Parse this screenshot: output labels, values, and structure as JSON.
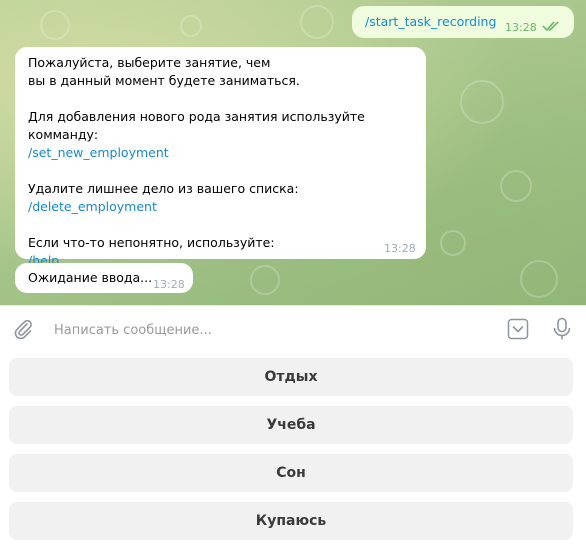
{
  "chat": {
    "outgoing": {
      "text": "/start_task_recording",
      "time": "13:28"
    },
    "bot_message": {
      "line1": "Пожалуйста, выберите занятие, чем",
      "line2": "вы в данный момент будете заниматься.",
      "line3": "Для добавления нового рода занятия используйте комманду:",
      "link1": "/set_new_employment",
      "line4": "Удалите лишнее дело из вашего списка:",
      "link2": "/delete_employment",
      "line5": "Если что-то непонятно, используйте:",
      "link3": "/help",
      "time": "13:28"
    },
    "waiting_message": {
      "text": "Ожидание ввода...",
      "time": "13:28"
    }
  },
  "composer": {
    "placeholder": "Написать сообщение...",
    "icons": [
      "paperclip-icon",
      "keyboard-toggle-icon",
      "microphone-icon"
    ]
  },
  "keyboard": {
    "buttons": [
      "Отдых",
      "Учеба",
      "Сон",
      "Купаюсь"
    ]
  },
  "colors": {
    "outgoing_bubble": "#effdde",
    "incoming_bubble": "#ffffff",
    "link": "#168acd",
    "keyboard_button": "#f1f1f1"
  }
}
